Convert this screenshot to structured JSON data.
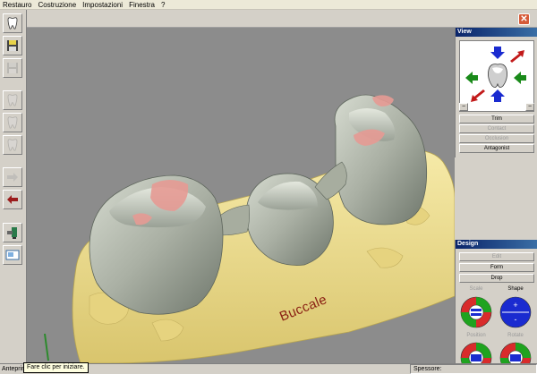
{
  "menu": [
    "Restauro",
    "Costruzione",
    "Impostazioni",
    "Finestra",
    "?"
  ],
  "close_glyph": "✕",
  "toolbar": {
    "icons": [
      "tooth-icon",
      "save-icon",
      "save-disabled-icon",
      "tooth-disabled-icon",
      "tooth-disabled-icon",
      "tooth-disabled-icon",
      "arrow-right-icon",
      "arrow-left-icon",
      "scanner-icon",
      "screen-icon"
    ]
  },
  "viewport": {
    "label": "Buccale",
    "background": "#8c8c8c",
    "model_color": "#f2e39a",
    "crown_color": "#b8bdb2",
    "contact_color": "#e59a94"
  },
  "view_panel": {
    "title": "View",
    "minus_left": "−",
    "minus_right": "−",
    "buttons": [
      {
        "label": "Trim",
        "enabled": true
      },
      {
        "label": "Contact",
        "enabled": false
      },
      {
        "label": "Occlusion",
        "enabled": false
      },
      {
        "label": "Antagonist",
        "enabled": true
      }
    ]
  },
  "design_panel": {
    "title": "Design",
    "buttons": [
      {
        "label": "Edit",
        "enabled": false
      },
      {
        "label": "Form",
        "enabled": true
      },
      {
        "label": "Drop",
        "enabled": true
      }
    ],
    "dial_labels": {
      "scale": "Scale",
      "shape": "Shape",
      "position": "Position",
      "rotate": "Rotate"
    },
    "shape_plus": "+",
    "shape_minus": "-"
  },
  "status": {
    "left": "Anteprim",
    "tooltip": "Fare clic per iniziare.",
    "right": "Spessore:"
  }
}
